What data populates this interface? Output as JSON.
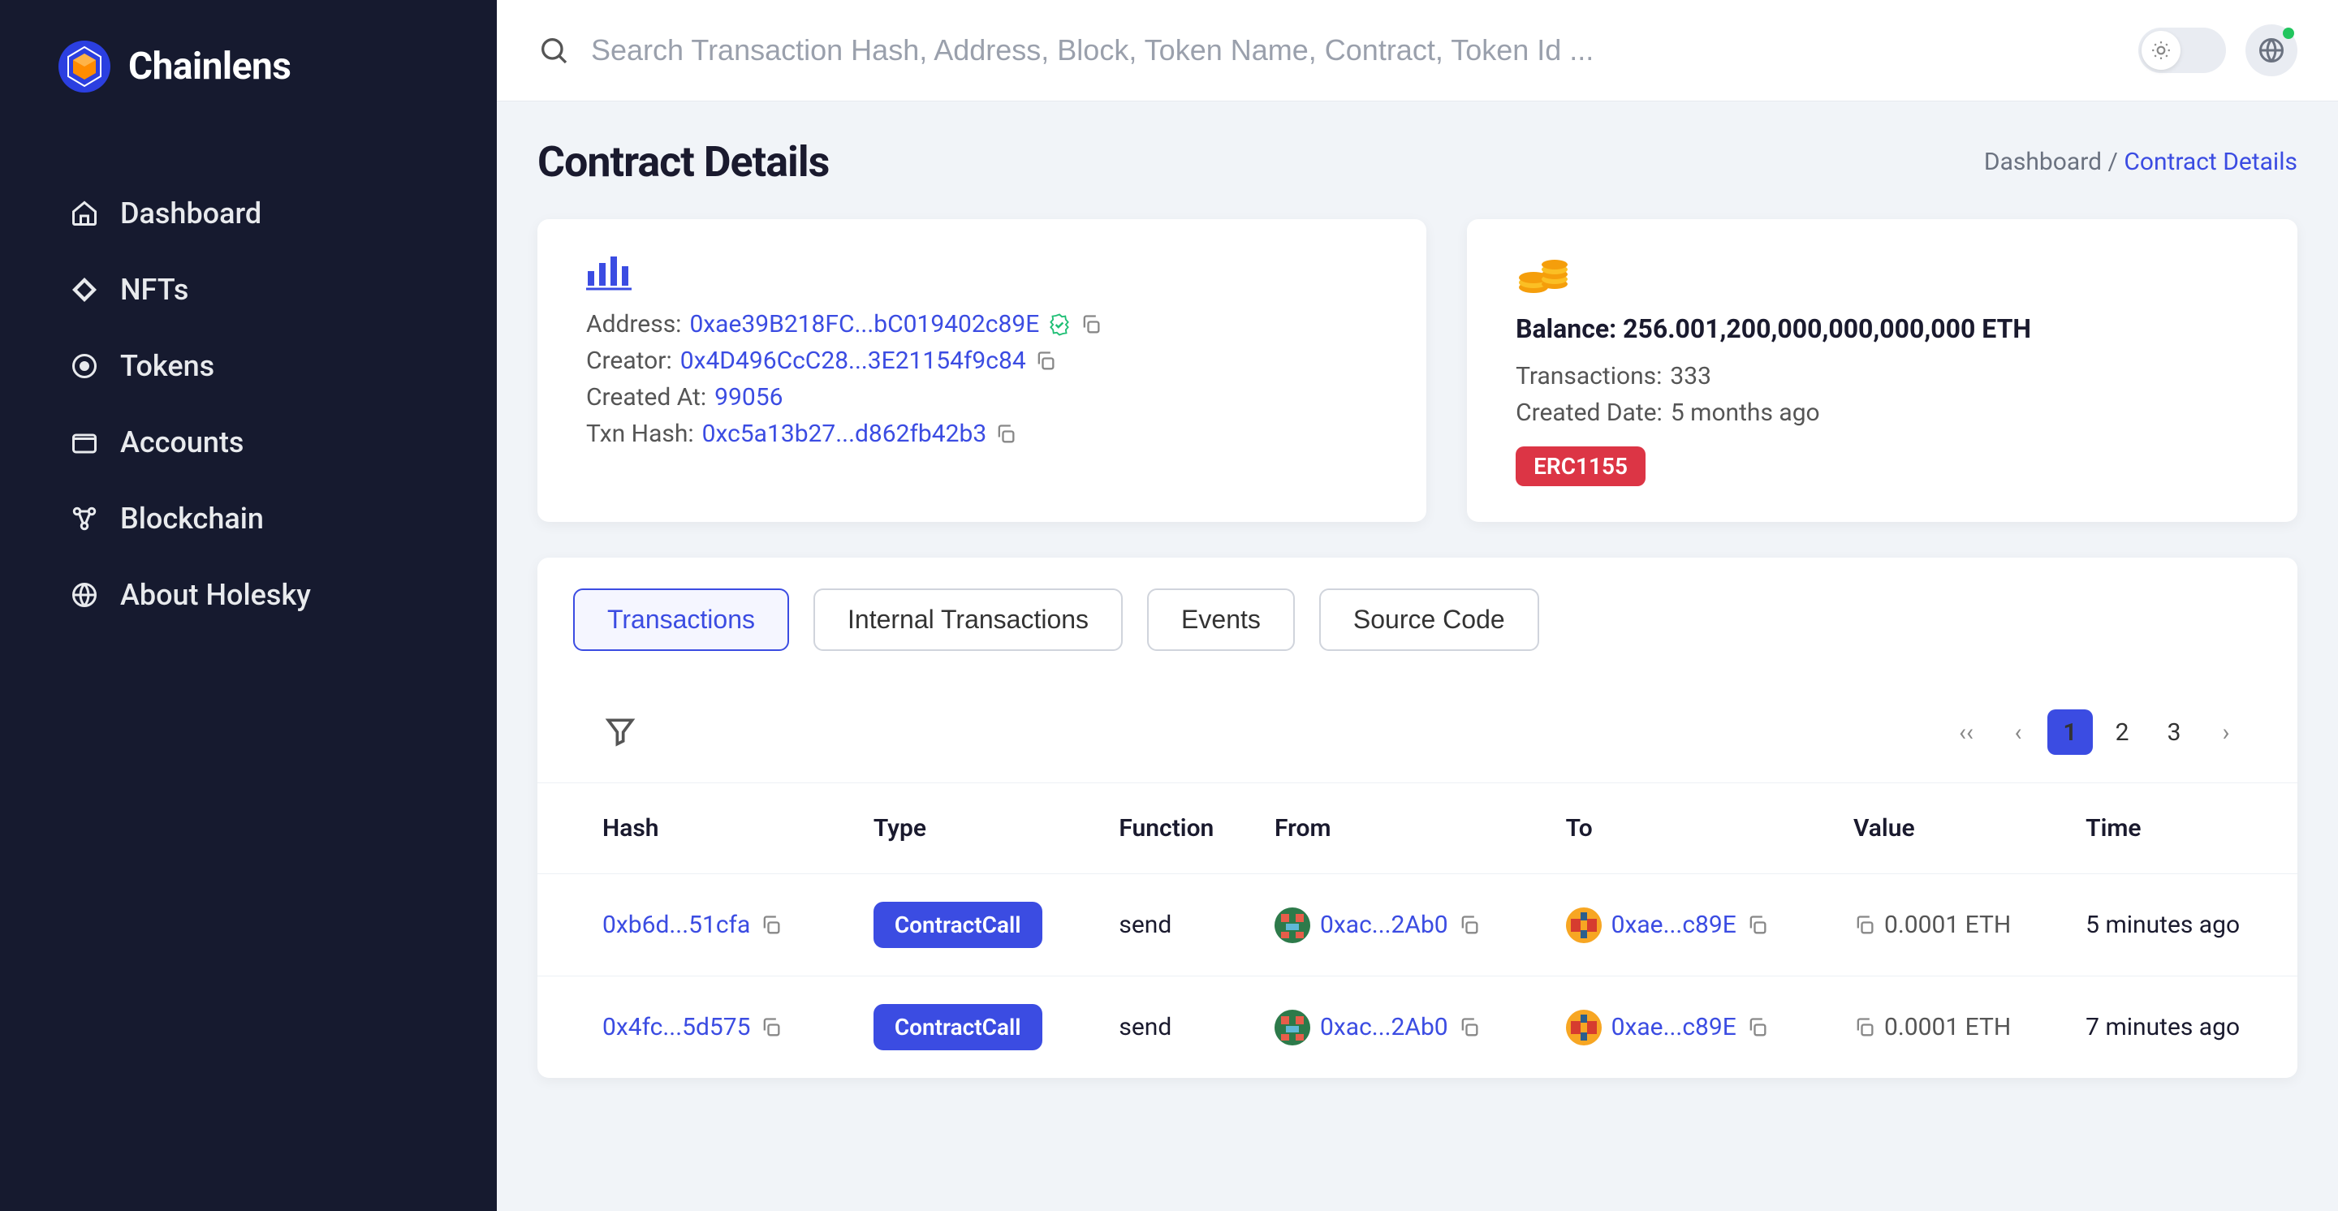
{
  "brand": "Chainlens",
  "search": {
    "placeholder": "Search Transaction Hash, Address, Block, Token Name, Contract, Token Id ..."
  },
  "nav": [
    {
      "label": "Dashboard"
    },
    {
      "label": "NFTs"
    },
    {
      "label": "Tokens"
    },
    {
      "label": "Accounts"
    },
    {
      "label": "Blockchain"
    },
    {
      "label": "About Holesky"
    }
  ],
  "page": {
    "title": "Contract Details",
    "breadcrumb_root": "Dashboard",
    "breadcrumb_sep": "/",
    "breadcrumb_current": "Contract Details"
  },
  "details": {
    "address_label": "Address:",
    "address": "0xae39B218FC...bC019402c89E",
    "creator_label": "Creator:",
    "creator": "0x4D496CcC28...3E21154f9c84",
    "created_at_label": "Created At:",
    "created_at": "99056",
    "txn_hash_label": "Txn Hash:",
    "txn_hash": "0xc5a13b27...d862fb42b3"
  },
  "summary": {
    "balance_label": "Balance:",
    "balance_value": "256.001,200,000,000,000,000 ETH",
    "tx_label": "Transactions:",
    "tx_count": "333",
    "created_date_label": "Created Date:",
    "created_date": "5 months ago",
    "standard": "ERC1155"
  },
  "tabs": [
    {
      "label": "Transactions",
      "active": true
    },
    {
      "label": "Internal Transactions",
      "active": false
    },
    {
      "label": "Events",
      "active": false
    },
    {
      "label": "Source Code",
      "active": false
    }
  ],
  "pagination": {
    "pages": [
      "1",
      "2",
      "3"
    ],
    "active": "1"
  },
  "columns": [
    "Hash",
    "Type",
    "Function",
    "From",
    "To",
    "Value",
    "Time"
  ],
  "rows": [
    {
      "hash": "0xb6d...51cfa",
      "type": "ContractCall",
      "function": "send",
      "from": "0xac...2Ab0",
      "to": "0xae...c89E",
      "value": "0.0001 ETH",
      "time": "5 minutes ago"
    },
    {
      "hash": "0x4fc...5d575",
      "type": "ContractCall",
      "function": "send",
      "from": "0xac...2Ab0",
      "to": "0xae...c89E",
      "value": "0.0001 ETH",
      "time": "7 minutes ago"
    }
  ]
}
